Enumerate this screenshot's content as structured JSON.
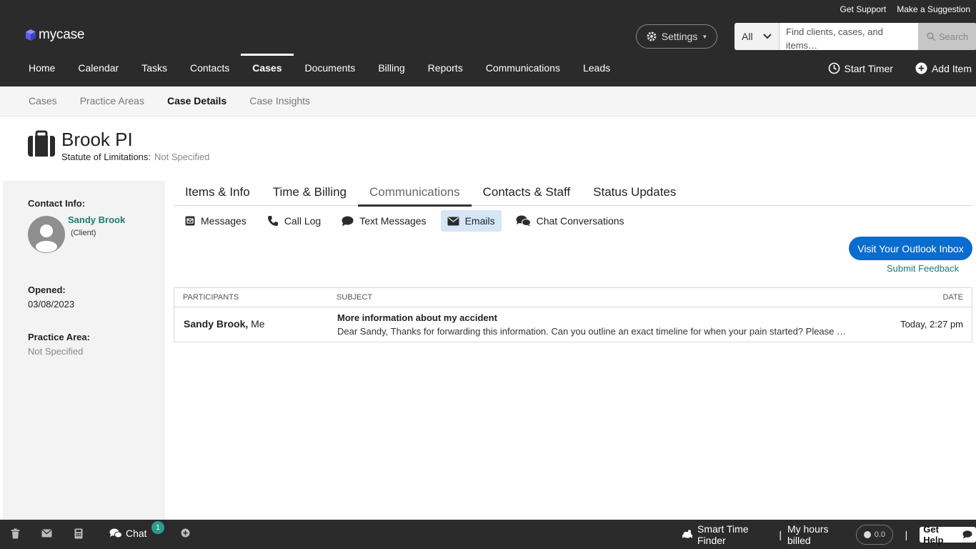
{
  "header": {
    "utility_links": [
      "Get Support",
      "Make a Suggestion"
    ],
    "logo_text": "mycase",
    "settings_label": "Settings",
    "search": {
      "scope": "All",
      "placeholder": "Find clients, cases, and items…",
      "button_label": "Search"
    },
    "nav": [
      "Home",
      "Calendar",
      "Tasks",
      "Contacts",
      "Cases",
      "Documents",
      "Billing",
      "Reports",
      "Communications",
      "Leads"
    ],
    "nav_active": "Cases",
    "start_timer_label": "Start Timer",
    "add_item_label": "Add Item"
  },
  "subnav": {
    "items": [
      "Cases",
      "Practice Areas",
      "Case Details",
      "Case Insights"
    ],
    "active": "Case Details"
  },
  "case": {
    "title": "Brook PI",
    "sol_label": "Statute of Limitations:",
    "sol_value": "Not Specified"
  },
  "sidebar": {
    "contact_label": "Contact Info:",
    "contact_name": "Sandy Brook",
    "contact_role": "(Client)",
    "opened_label": "Opened:",
    "opened_value": "03/08/2023",
    "practice_label": "Practice Area:",
    "practice_value": "Not Specified"
  },
  "case_tabs": [
    "Items & Info",
    "Time & Billing",
    "Communications",
    "Contacts & Staff",
    "Status Updates"
  ],
  "case_tab_active": "Communications",
  "comm_tabs": [
    {
      "label": "Messages",
      "icon": "envelope-square-icon"
    },
    {
      "label": "Call Log",
      "icon": "phone-icon"
    },
    {
      "label": "Text Messages",
      "icon": "speech-bubble-icon"
    },
    {
      "label": "Emails",
      "icon": "envelope-icon"
    },
    {
      "label": "Chat Conversations",
      "icon": "chat-bubbles-icon"
    }
  ],
  "comm_tab_active": "Emails",
  "outlook_button": "Visit Your Outlook Inbox",
  "feedback_link": "Submit Feedback",
  "table": {
    "headers": {
      "participants": "Participants",
      "subject": "Subject",
      "date": "Date"
    },
    "rows": [
      {
        "participant_primary": "Sandy Brook,",
        "participant_secondary": " Me",
        "subject": "More information about my accident",
        "snippet": "Dear Sandy, Thanks for forwarding this information. Can you outline an exact timeline for when your pain started? Please …",
        "date": "Today, 2:27 pm"
      }
    ]
  },
  "footer": {
    "chat_label": "Chat",
    "chat_badge": "1",
    "smart_time_finder": "Smart Time Finder",
    "separator": "|",
    "hours_billed_label": "My hours billed",
    "hours_billed_value": "0.0",
    "get_help_label": "Get Help"
  },
  "colors": {
    "header_bg": "#2b2b2b",
    "accent_teal": "#1b7a74",
    "primary_blue": "#0b6ccf",
    "active_tab_bg": "#d5e6f7"
  }
}
